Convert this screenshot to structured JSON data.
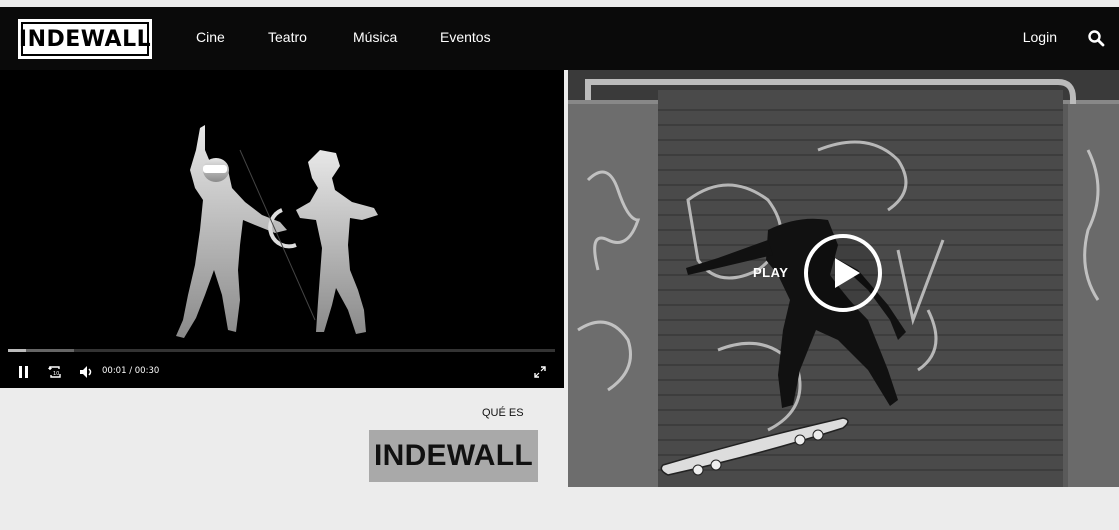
{
  "brand": {
    "logo_text": "INDEWALL"
  },
  "nav": {
    "items": [
      {
        "label": "Cine"
      },
      {
        "label": "Teatro"
      },
      {
        "label": "Música"
      },
      {
        "label": "Eventos"
      }
    ],
    "login_label": "Login",
    "search_icon": "search-icon"
  },
  "video": {
    "time_display": "00:01 / 00:30",
    "progress": 0.033,
    "buffered": 0.12,
    "controls": [
      "pause-icon",
      "replay-10-icon",
      "volume-icon",
      "fullscreen-icon"
    ]
  },
  "about": {
    "eyebrow": "QUÉ ES",
    "title": "INDEWALL"
  },
  "feature": {
    "play_label": "PLAY"
  },
  "colors": {
    "navbar": "#0a0a0a",
    "page_background": "#ececec",
    "title_highlight": "#a9a9a9"
  }
}
